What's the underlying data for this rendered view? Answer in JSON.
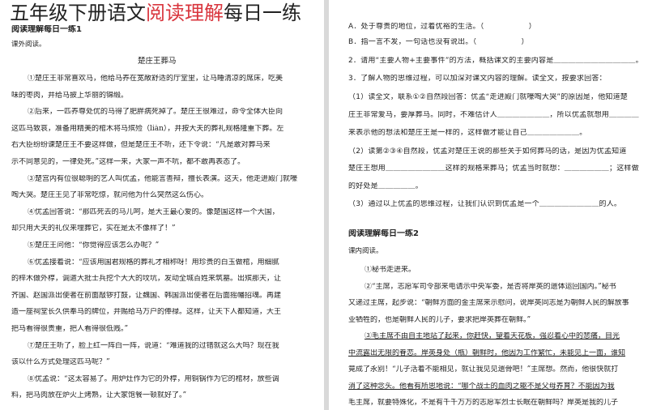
{
  "header": {
    "title_part1": "五年级下册语文",
    "title_part2": "阅读理解",
    "title_part3": "每日一练"
  },
  "ex1": {
    "heading": "阅读理解每日一练1",
    "intro": "课外阅读。",
    "story_title": "楚庄王葬马",
    "lines": [
      "①楚庄王非常喜欢马，他给马养在宽敞舒适的厅堂里，让马睡清凉的席床，吃美",
      "味的枣肉，并给马披上华丽的锦缎。",
      "②后来，一匹养尊处优的马得了肥胖病死掉了。楚庄王很难过，命令全体大臣向",
      "这匹马致哀，准备用精美的棺木将马殡殓（liàn），并按大夫的葬礼规格隆重下葬。左",
      "右大臣纷纷谏楚庄王不要这样做，但是楚庄王不听，还下令说：“凡是敢对葬马来",
      "示不同意见的，一律处死。”这样一来，大家一声不吭，都不敢再表态了。",
      "③楚宫内有位很聪明的艺人叫优孟，他能言善辩，擅长表演。这天，他走进殿门就嚎",
      "啕大哭。楚庄王见了非常吃惊，就问他为什么突然这么伤心。",
      "④优孟回答说：“那匹死去的马儿呵，是大王最心爱的。像楚国这样一个大国，",
      "却只用大夫的礼仪来埋葬它，实在是太不像样了！”",
      "⑤楚庄王问他：“你觉得应该怎么办呢？”",
      "⑥优孟接着说：“应该用国君规格的葬礼才相称呀！用珍贵的白玉做棺，用细腻",
      "的梓木做外椁，调遣大批士兵挖个大大的坟坑，发动全城百姓来筑墓。出殡那天，让",
      "齐国、赵国派出使者在前面敲锣打鼓，让魏国、韩国派出使者在后面摇幡招魂。再建",
      "造一座祠堂长久供奉马的牌位，并赐给马万户的俸禄。这样，让天下人都知道，大王",
      "把马看得很贵重，把人看得很低贱。”",
      "⑦楚庄王听了，脸上红一阵白一阵，说道：“难道我的过错就这么大吗？现在我",
      "该以什么方式处理这匹马呢？”",
      "⑧优孟说：“这太容易了。用炉灶作为它的外椁，用铜锅作为它的棺材，放些调",
      "料，把马肉放在炉火上烤熟，让大家饱餐一顿就好了。”"
    ]
  },
  "questions": {
    "qA": "A．处于尊贵的地位，过着优裕的生活。（　　　　　　）",
    "qB": "B．指一言不发，一句话也没有说出。（　　　　　　）",
    "q2": "2．请用“主要人物+主要事件”的方法，概括课文的主要内容是＿＿＿＿＿＿＿＿＿＿＿。",
    "q3": "3．了解人物的思维过程，可以加深对课文内容的理解。读全文，按要求回答：",
    "q3_1a": "（1）读全文，联系①②自然段回答：优孟“走进殿门就嚎啕大哭”的原因是，他知道楚",
    "q3_1b": "庄王非常爱马，要厚葬马。同时，不难估计人＿＿＿＿＿＿＿，所以优孟就想用＿＿＿＿",
    "q3_1c": "来表示他的想法和楚庄王是一样的，这样做才能让自己＿＿＿＿＿＿＿。",
    "q3_2a": "（2）读第②③④自然段，优孟对楚庄王说的那些关于如何葬马的话，是因为优孟知道",
    "q3_2b": "楚庄王想用＿＿＿＿＿＿＿＿这样的规格来葬马；优孟当时就想：＿＿＿＿＿＿；这样做",
    "q3_2c": "的好处是＿＿＿＿＿。",
    "q3_3": "（3）通过以上优孟的思维过程，让我们认识到优孟是一个＿＿＿＿＿＿＿＿的人。"
  },
  "ex2": {
    "heading": "阅读理解每日一练2",
    "intro": "课内阅读。",
    "lines": [
      "①秘书走进来。",
      "②“主席，志愿军司令部来电请示中央军委，是否将岸英的遗体运回国内。”秘书",
      "又递过主席，起步说：“朝鲜方面的金主席来示慰问，说岸英同志是为朝鲜人民的解放事",
      "业牺牲的，也是朝鲜人民的儿子，要求把岸英葬在朝鲜。”",
      "③毛主席不由自主地站了起来，你赶快，望着天花板，强忍着心中的悲痛，目光",
      "中流露出无限的眷恋。岸英身处（瓶）朝鲜时，他因为工作繁忙，未能见上一面，谁知",
      "竟成了永别！“儿子活着不能相见，就让我见见遗骨吧！”主席想。然而，他很快就打",
      "消了这种念头。他看有所思地说：“哪个战士的血肉之躯不是父母养育？不能因为我",
      "毛主席，就要特殊化，不是有千千万万的志愿军烈士长眠在朝鲜吗？岸英是我的儿子"
    ]
  }
}
